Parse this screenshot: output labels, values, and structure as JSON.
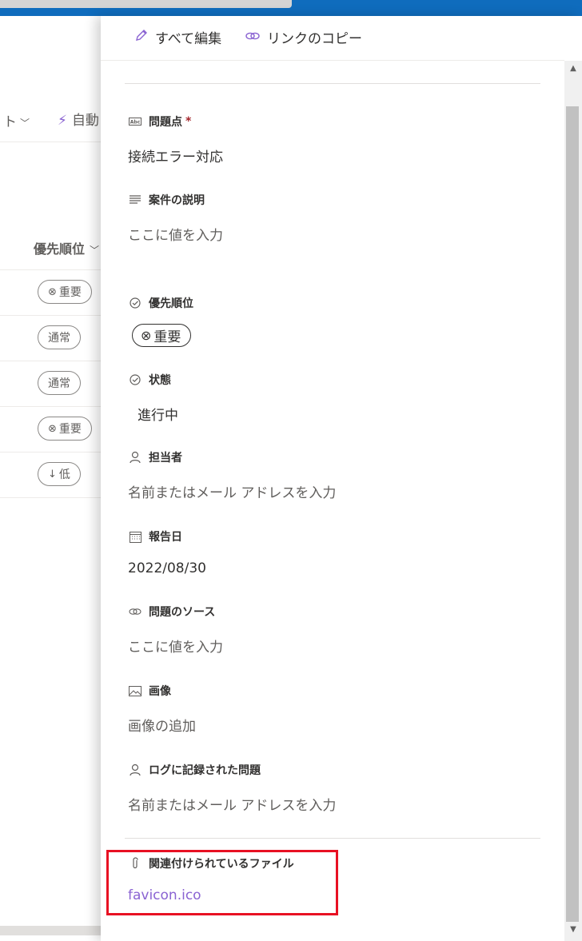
{
  "background_list": {
    "view_selector": "ト",
    "automate_label": "自動",
    "column_header": "優先順位",
    "rows": [
      {
        "icon": "⊗",
        "label": "重要"
      },
      {
        "icon": "",
        "label": "通常"
      },
      {
        "icon": "",
        "label": "通常"
      },
      {
        "icon": "⊗",
        "label": "重要"
      },
      {
        "icon": "↓",
        "label": "低"
      }
    ]
  },
  "panel": {
    "edit_all": "すべて編集",
    "copy_link": "リンクのコピー",
    "fields": {
      "issue": {
        "label": "問題点",
        "required_mark": "*",
        "value": "接続エラー対応",
        "icon": "abc-text-icon"
      },
      "description": {
        "label": "案件の説明",
        "placeholder": "ここに値を入力",
        "icon": "multiline-text-icon"
      },
      "priority": {
        "label": "優先順位",
        "value_icon": "⊗",
        "value": "重要",
        "icon": "choice-icon"
      },
      "status": {
        "label": "状態",
        "value": "進行中",
        "icon": "choice-icon"
      },
      "assignee": {
        "label": "担当者",
        "placeholder": "名前またはメール アドレスを入力",
        "icon": "person-icon"
      },
      "reported_date": {
        "label": "報告日",
        "value": "2022/08/30",
        "icon": "calendar-icon"
      },
      "issue_source": {
        "label": "問題のソース",
        "placeholder": "ここに値を入力",
        "icon": "link-icon"
      },
      "image": {
        "label": "画像",
        "placeholder": "画像の追加",
        "icon": "image-icon"
      },
      "logged_by": {
        "label": "ログに記録された問題",
        "placeholder": "名前またはメール アドレスを入力",
        "icon": "person-icon"
      },
      "attachments": {
        "label": "関連付けられているファイル",
        "file": "favicon.ico",
        "icon": "paperclip-icon"
      }
    }
  },
  "colors": {
    "accent": "#8a63d2",
    "highlight": "#e81123",
    "titlebar": "#0f6cbd"
  }
}
